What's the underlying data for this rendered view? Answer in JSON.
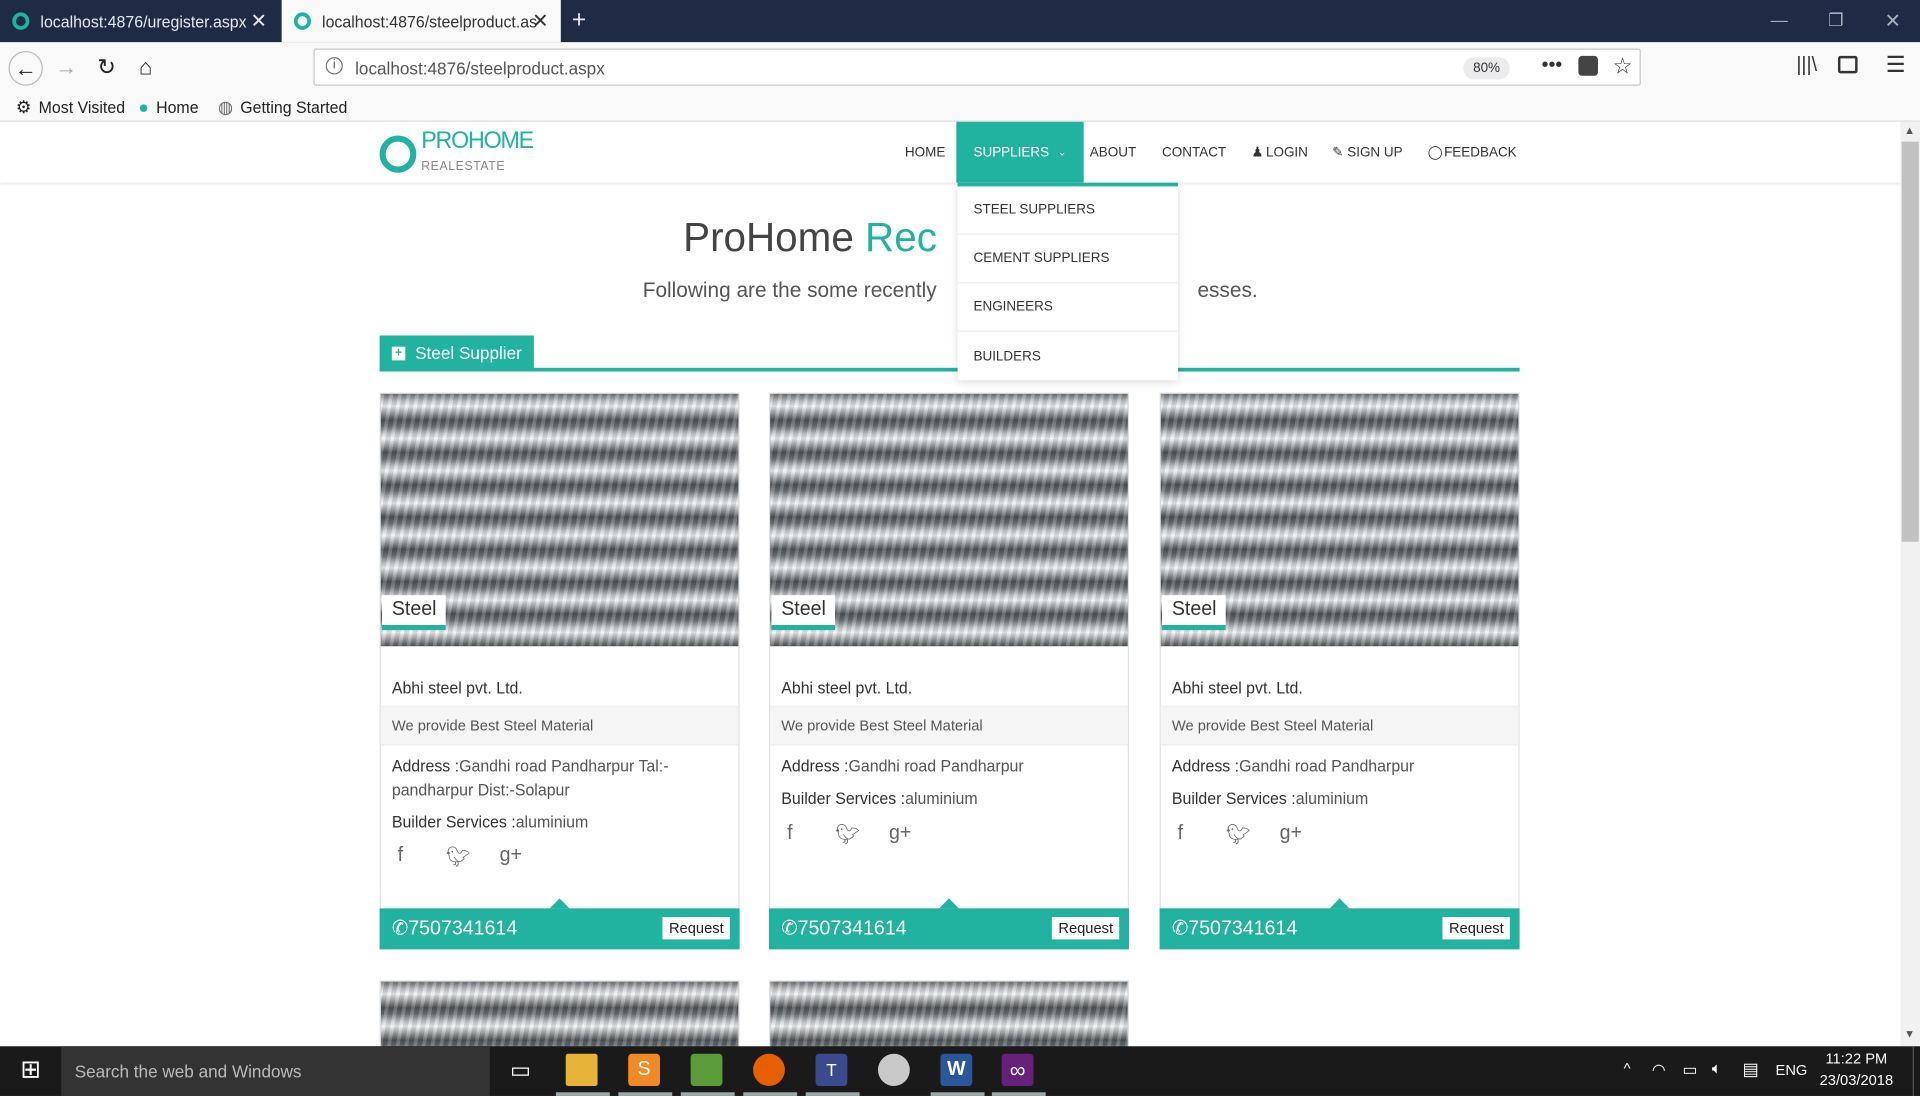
{
  "browser": {
    "tabs": [
      {
        "title": "localhost:4876/uregister.aspx"
      },
      {
        "title": "localhost:4876/steelproduct.aspx"
      }
    ],
    "url": "localhost:4876/steelproduct.aspx",
    "zoom": "80%",
    "bookmarks": [
      "Most Visited",
      "Home",
      "Getting Started"
    ]
  },
  "site": {
    "logo_pro": "PRO",
    "logo_home": "HOME",
    "logo_sub": "REALESTATE",
    "menu": [
      "HOME",
      "SUPPLIERS",
      "ABOUT",
      "CONTACT",
      "LOGIN",
      "SIGN UP",
      "FEEDBACK"
    ],
    "dropdown": [
      "STEEL SUPPLIERS",
      "CEMENT SUPPLIERS",
      "ENGINEERS",
      "BUILDERS"
    ],
    "title_main": "ProHome ",
    "title_teal": "Rec",
    "subtitle": "Following are the some recently",
    "subtitle_tail": "esses.",
    "section": "Steel Supplier"
  },
  "cards": [
    {
      "tag": "Steel",
      "name": "Abhi steel pvt. Ltd.",
      "desc": "We provide Best Steel Material",
      "address_label": "Address :",
      "address": "Gandhi road Pandharpur Tal:-pandharpur Dist:-Solapur",
      "services_label": "Builder Services :",
      "services": "aluminium",
      "phone": "7507341614",
      "request": "Request"
    },
    {
      "tag": "Steel",
      "name": "Abhi steel pvt. Ltd.",
      "desc": "We provide Best Steel Material",
      "address_label": "Address :",
      "address": "Gandhi road Pandharpur",
      "services_label": "Builder Services :",
      "services": "aluminium",
      "phone": "7507341614",
      "request": "Request"
    },
    {
      "tag": "Steel",
      "name": "Abhi steel pvt. Ltd.",
      "desc": "We provide Best Steel Material",
      "address_label": "Address :",
      "address": "Gandhi road Pandharpur",
      "services_label": "Builder Services :",
      "services": "aluminium",
      "phone": "7507341614",
      "request": "Request"
    }
  ],
  "taskbar": {
    "search": "Search the web and Windows",
    "lang": "ENG",
    "time": "11:22 PM",
    "date": "23/03/2018"
  }
}
